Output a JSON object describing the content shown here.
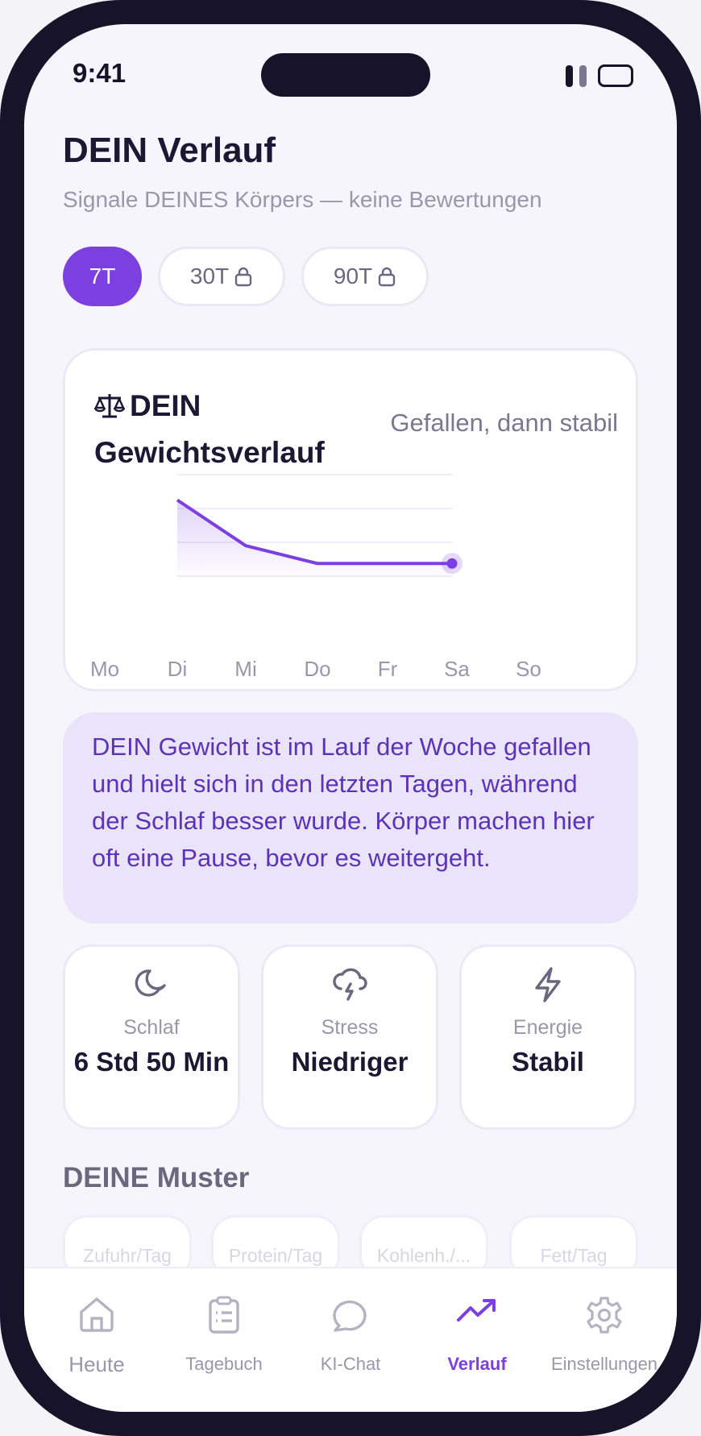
{
  "status_bar": {
    "time": "9:41"
  },
  "header": {
    "title": "DEIN Verlauf",
    "subtitle": "Signale DEINES Körpers — keine Bewertungen"
  },
  "range_tabs": [
    {
      "label": "7T",
      "active": true,
      "locked": false
    },
    {
      "label": "30T",
      "active": false,
      "locked": true
    },
    {
      "label": "90T",
      "active": false,
      "locked": true
    }
  ],
  "weight_card": {
    "title": "DEIN Gewichtsverlauf",
    "status": "Gefallen, dann stabil",
    "icon": "scale-icon"
  },
  "chart_data": {
    "type": "area",
    "categories": [
      "Mo",
      "Di",
      "Mi",
      "Do",
      "Fr",
      "Sa",
      "So"
    ],
    "series": [
      {
        "values": [
          null,
          3,
          1.2,
          0.5,
          0.5,
          0.5,
          null
        ]
      }
    ],
    "ylim": [
      0,
      4
    ],
    "grid": true,
    "accent_color": "#7c3fe0"
  },
  "insight_text": "DEIN Gewicht ist im Lauf der Woche gefallen und hielt sich in den letzten Tagen, während der Schlaf besser wurde. Körper machen hier oft eine Pause, bevor es weitergeht.",
  "metrics": [
    {
      "icon": "moon-icon",
      "label": "Schlaf",
      "value": "6 Std 50 Min"
    },
    {
      "icon": "storm-cloud-icon",
      "label": "Stress",
      "value": "Niedriger"
    },
    {
      "icon": "lightning-icon",
      "label": "Energie",
      "value": "Stabil"
    }
  ],
  "patterns": {
    "title": "DEINE Muster",
    "chips": [
      "Zufuhr/Tag",
      "Protein/Tag",
      "Kohlenh./...",
      "Fett/Tag"
    ]
  },
  "tab_bar": [
    {
      "label": "Heute",
      "icon": "home-icon",
      "active": false
    },
    {
      "label": "Tagebuch",
      "icon": "clipboard-icon",
      "active": false
    },
    {
      "label": "KI-Chat",
      "icon": "chat-bubble-icon",
      "active": false
    },
    {
      "label": "Verlauf",
      "icon": "trending-up-icon",
      "active": true
    },
    {
      "label": "Einstellungen",
      "icon": "gear-icon",
      "active": false
    }
  ],
  "colors": {
    "accent": "#7c3fe0",
    "frame": "#17142a",
    "insight_bg": "#e9e4fa",
    "insight_text": "#5b32b8"
  }
}
